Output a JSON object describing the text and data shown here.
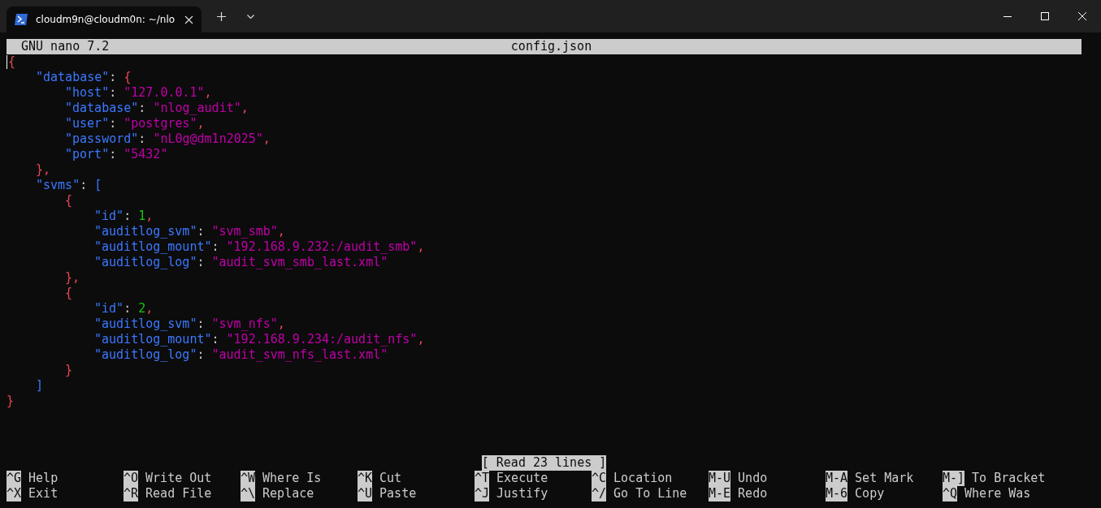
{
  "window": {
    "tab_title": "cloudm9n@cloudm0n: ~/nlo"
  },
  "editor": {
    "app": "GNU nano 7.2",
    "filename": "config.json"
  },
  "code": [
    {
      "tokens": [
        {
          "kind": "brace",
          "text": "{"
        }
      ],
      "children": [
        {
          "tokens": [
            {
              "kind": "key",
              "text": "\"database\""
            },
            {
              "kind": "colon",
              "text": ": "
            },
            {
              "kind": "brace",
              "text": "{"
            }
          ],
          "children": [
            {
              "tokens": [
                {
                  "kind": "key",
                  "text": "\"host\""
                },
                {
                  "kind": "colon",
                  "text": ": "
                },
                {
                  "kind": "string",
                  "text": "\"127.0.0.1\""
                },
                {
                  "kind": "comma",
                  "text": ","
                }
              ]
            },
            {
              "tokens": [
                {
                  "kind": "key",
                  "text": "\"database\""
                },
                {
                  "kind": "colon",
                  "text": ": "
                },
                {
                  "kind": "string",
                  "text": "\"nlog_audit\""
                },
                {
                  "kind": "comma",
                  "text": ","
                }
              ]
            },
            {
              "tokens": [
                {
                  "kind": "key",
                  "text": "\"user\""
                },
                {
                  "kind": "colon",
                  "text": ": "
                },
                {
                  "kind": "string",
                  "text": "\"postgres\""
                },
                {
                  "kind": "comma",
                  "text": ","
                }
              ]
            },
            {
              "tokens": [
                {
                  "kind": "key",
                  "text": "\"password\""
                },
                {
                  "kind": "colon",
                  "text": ": "
                },
                {
                  "kind": "string",
                  "text": "\"nL0g@dm1n2025\""
                },
                {
                  "kind": "comma",
                  "text": ","
                }
              ]
            },
            {
              "tokens": [
                {
                  "kind": "key",
                  "text": "\"port\""
                },
                {
                  "kind": "colon",
                  "text": ": "
                },
                {
                  "kind": "string",
                  "text": "\"5432\""
                }
              ]
            }
          ]
        },
        {
          "tokens": [
            {
              "kind": "brace",
              "text": "}"
            },
            {
              "kind": "comma",
              "text": ","
            }
          ]
        },
        {
          "tokens": [
            {
              "kind": "key",
              "text": "\"svms\""
            },
            {
              "kind": "colon",
              "text": ": "
            },
            {
              "kind": "bracket",
              "text": "["
            }
          ],
          "children": [
            {
              "tokens": [
                {
                  "kind": "brace",
                  "text": "{"
                }
              ],
              "children": [
                {
                  "tokens": [
                    {
                      "kind": "key",
                      "text": "\"id\""
                    },
                    {
                      "kind": "colon",
                      "text": ": "
                    },
                    {
                      "kind": "number",
                      "text": "1"
                    },
                    {
                      "kind": "comma",
                      "text": ","
                    }
                  ]
                },
                {
                  "tokens": [
                    {
                      "kind": "key",
                      "text": "\"auditlog_svm\""
                    },
                    {
                      "kind": "colon",
                      "text": ": "
                    },
                    {
                      "kind": "string",
                      "text": "\"svm_smb\""
                    },
                    {
                      "kind": "comma",
                      "text": ","
                    }
                  ]
                },
                {
                  "tokens": [
                    {
                      "kind": "key",
                      "text": "\"auditlog_mount\""
                    },
                    {
                      "kind": "colon",
                      "text": ": "
                    },
                    {
                      "kind": "string",
                      "text": "\"192.168.9.232:/audit_smb\""
                    },
                    {
                      "kind": "comma",
                      "text": ","
                    }
                  ]
                },
                {
                  "tokens": [
                    {
                      "kind": "key",
                      "text": "\"auditlog_log\""
                    },
                    {
                      "kind": "colon",
                      "text": ": "
                    },
                    {
                      "kind": "string",
                      "text": "\"audit_svm_smb_last.xml\""
                    }
                  ]
                }
              ]
            },
            {
              "tokens": [
                {
                  "kind": "brace",
                  "text": "}"
                },
                {
                  "kind": "comma",
                  "text": ","
                }
              ]
            },
            {
              "tokens": [
                {
                  "kind": "brace",
                  "text": "{"
                }
              ],
              "children": [
                {
                  "tokens": [
                    {
                      "kind": "key",
                      "text": "\"id\""
                    },
                    {
                      "kind": "colon",
                      "text": ": "
                    },
                    {
                      "kind": "number",
                      "text": "2"
                    },
                    {
                      "kind": "comma",
                      "text": ","
                    }
                  ]
                },
                {
                  "tokens": [
                    {
                      "kind": "key",
                      "text": "\"auditlog_svm\""
                    },
                    {
                      "kind": "colon",
                      "text": ": "
                    },
                    {
                      "kind": "string",
                      "text": "\"svm_nfs\""
                    },
                    {
                      "kind": "comma",
                      "text": ","
                    }
                  ]
                },
                {
                  "tokens": [
                    {
                      "kind": "key",
                      "text": "\"auditlog_mount\""
                    },
                    {
                      "kind": "colon",
                      "text": ": "
                    },
                    {
                      "kind": "string",
                      "text": "\"192.168.9.234:/audit_nfs\""
                    },
                    {
                      "kind": "comma",
                      "text": ","
                    }
                  ]
                },
                {
                  "tokens": [
                    {
                      "kind": "key",
                      "text": "\"auditlog_log\""
                    },
                    {
                      "kind": "colon",
                      "text": ": "
                    },
                    {
                      "kind": "string",
                      "text": "\"audit_svm_nfs_last.xml\""
                    }
                  ]
                }
              ]
            },
            {
              "tokens": [
                {
                  "kind": "brace",
                  "text": "}"
                }
              ]
            }
          ]
        },
        {
          "tokens": [
            {
              "kind": "bracket",
              "text": "]"
            }
          ]
        }
      ]
    },
    {
      "tokens": [
        {
          "kind": "brace",
          "text": "}"
        }
      ]
    }
  ],
  "status": "[ Read 23 lines ]",
  "shortcuts": [
    [
      {
        "key": "^G",
        "label": "Help"
      },
      {
        "key": "^O",
        "label": "Write Out"
      },
      {
        "key": "^W",
        "label": "Where Is"
      },
      {
        "key": "^K",
        "label": "Cut"
      },
      {
        "key": "^T",
        "label": "Execute"
      },
      {
        "key": "^C",
        "label": "Location"
      },
      {
        "key": "M-U",
        "label": "Undo"
      },
      {
        "key": "M-A",
        "label": "Set Mark"
      },
      {
        "key": "M-]",
        "label": "To Bracket"
      }
    ],
    [
      {
        "key": "^X",
        "label": "Exit"
      },
      {
        "key": "^R",
        "label": "Read File"
      },
      {
        "key": "^\\",
        "label": "Replace"
      },
      {
        "key": "^U",
        "label": "Paste"
      },
      {
        "key": "^J",
        "label": "Justify"
      },
      {
        "key": "^/",
        "label": "Go To Line"
      },
      {
        "key": "M-E",
        "label": "Redo"
      },
      {
        "key": "M-6",
        "label": "Copy"
      },
      {
        "key": "^Q",
        "label": "Where Was"
      }
    ]
  ]
}
